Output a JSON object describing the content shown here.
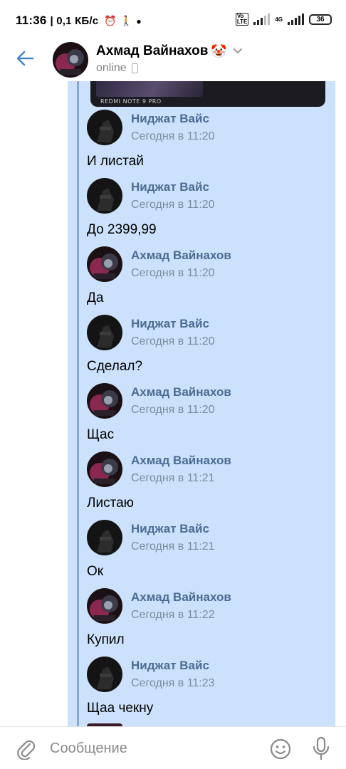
{
  "status_bar": {
    "time": "11:36",
    "speed": "| 0,1 КБ/с",
    "network": "4G",
    "battery": "36"
  },
  "header": {
    "title": "Ахмад Вайнахов",
    "emoji": "🤡",
    "status": "online"
  },
  "forwarded_photo": {
    "caption": "REDMI NOTE 9 PRO"
  },
  "messages": [
    {
      "author": "Ниджат Вайс",
      "time": "Сегодня в 11:20",
      "text": "И листай"
    },
    {
      "author": "Ниджат Вайс",
      "time": "Сегодня в 11:20",
      "text": "До 2399,99"
    },
    {
      "author": "Ахмад Вайнахов",
      "time": "Сегодня в 11:20",
      "text": "Да"
    },
    {
      "author": "Ниджат Вайс",
      "time": "Сегодня в 11:20",
      "text": "Сделал?"
    },
    {
      "author": "Ахмад Вайнахов",
      "time": "Сегодня в 11:20",
      "text": "Щас"
    },
    {
      "author": "Ахмад Вайнахов",
      "time": "Сегодня в 11:21",
      "text": "Листаю"
    },
    {
      "author": "Ниджат Вайс",
      "time": "Сегодня в 11:21",
      "text": "Ок"
    },
    {
      "author": "Ахмад Вайнахов",
      "time": "Сегодня в 11:22",
      "text": "Купил"
    },
    {
      "author": "Ниджат Вайс",
      "time": "Сегодня в 11:23",
      "text": "Щаа чекну"
    }
  ],
  "composer": {
    "placeholder": "Сообщение"
  },
  "colors": {
    "accent": "#4a86c7",
    "forward_bg": "#cce1fb",
    "author": "#4a6b92"
  },
  "icons": [
    "back-arrow-icon",
    "chevron-down-icon",
    "phone-icon",
    "paperclip-icon",
    "smile-icon",
    "microphone-icon"
  ]
}
